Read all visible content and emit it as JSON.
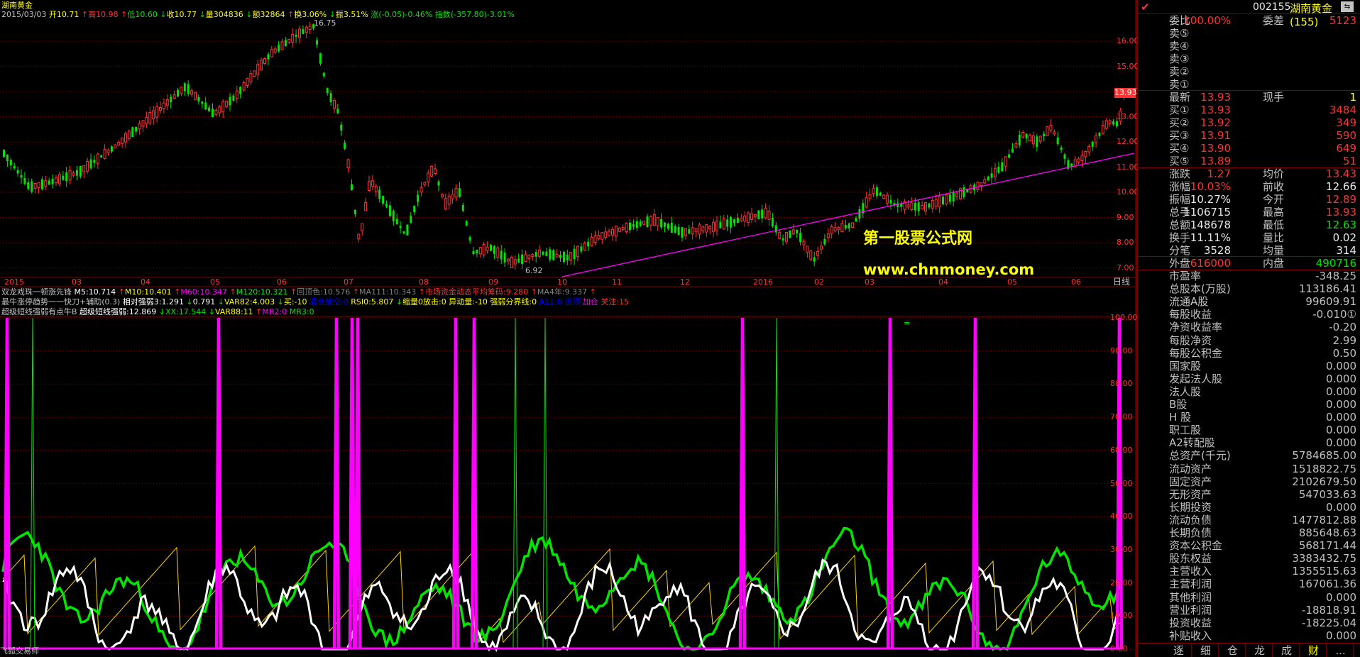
{
  "window": {
    "title": "湖南黄金",
    "footer": "飞狐交易师"
  },
  "info_line": {
    "date": "2015/03/03",
    "items": [
      {
        "t": "开10.71",
        "c": "#ffff00"
      },
      {
        "t": "↑",
        "c": "#ff3232"
      },
      {
        "t": "高10.98",
        "c": "#ff3232"
      },
      {
        "t": "↑",
        "c": "#ff3232"
      },
      {
        "t": "低10.60",
        "c": "#00e600"
      },
      {
        "t": "↓",
        "c": "#00e600"
      },
      {
        "t": "收10.77",
        "c": "#ffff00"
      },
      {
        "t": "↓",
        "c": "#00e600"
      },
      {
        "t": "量304836",
        "c": "#ffff00"
      },
      {
        "t": "↓",
        "c": "#00e600"
      },
      {
        "t": "额32864",
        "c": "#ffff00"
      },
      {
        "t": "↑",
        "c": "#ff3232"
      },
      {
        "t": "换3.06%",
        "c": "#ffff00"
      },
      {
        "t": "↓",
        "c": "#00e600"
      },
      {
        "t": "振3.51%",
        "c": "#ffff00"
      },
      {
        "t": "涨(-0.05)-0.46%",
        "c": "#00e600"
      },
      {
        "t": "指数(-357.80)-3.01%",
        "c": "#00e600"
      }
    ]
  },
  "main_chart": {
    "y_labels": [
      "16.00",
      "15.00",
      "14.00",
      "13.00",
      "12.00",
      "11.00",
      "10.00",
      "9.00",
      "8.00",
      "7.00"
    ],
    "current_price_tag": "13.93",
    "max_label": "16.75",
    "min_label": "6.92",
    "x_labels": [
      "2015",
      "03",
      "04",
      "05",
      "06",
      "07",
      "08",
      "09",
      "10",
      "11",
      "12",
      "2016",
      "02",
      "03",
      "04",
      "05",
      "06"
    ],
    "period_label": "日线"
  },
  "watermark": {
    "line1": "第一股票公式网",
    "line2": "www.chnmoney.com"
  },
  "indicator_lines": [
    [
      {
        "t": "双龙戏珠一顿涨先锋",
        "c": "#c0c0c0"
      },
      {
        "t": "M5:10.714",
        "c": "#ffffff"
      },
      {
        "t": "↑",
        "c": "#ff3232"
      },
      {
        "t": "M10:10.401",
        "c": "#ffff00"
      },
      {
        "t": "↑",
        "c": "#ff3232"
      },
      {
        "t": "M60:10.347",
        "c": "#ff00ff"
      },
      {
        "t": "↑",
        "c": "#ff3232"
      },
      {
        "t": "M120:10.321",
        "c": "#00e600"
      },
      {
        "t": "↑",
        "c": "#ff3232"
      },
      {
        "t": "回顶色:10.576",
        "c": "#808080"
      },
      {
        "t": "↑",
        "c": "#ff3232"
      },
      {
        "t": "MA111:10.343",
        "c": "#808080"
      },
      {
        "t": "↑",
        "c": "#ff3232"
      },
      {
        "t": "市场资金动态平均筹码:9.280",
        "c": "#ff3232"
      },
      {
        "t": "↑",
        "c": "#ff3232"
      },
      {
        "t": "MA4年:9.337",
        "c": "#808080"
      },
      {
        "t": "↑",
        "c": "#ff3232"
      }
    ],
    [
      {
        "t": "最牛涨停趋势一一快刀+辅助(0.3)",
        "c": "#c0c0c0"
      },
      {
        "t": "相对强弱3:1.291",
        "c": "#ffffff"
      },
      {
        "t": "↓",
        "c": "#00e600"
      },
      {
        "t": "0.791",
        "c": "#ffffff"
      },
      {
        "t": "↓",
        "c": "#00e600"
      },
      {
        "t": "VAR82:4.003",
        "c": "#ffff00"
      },
      {
        "t": "↓",
        "c": "#00e600"
      },
      {
        "t": "买:-10",
        "c": "#ffff00"
      },
      {
        "t": "清仓放空:0",
        "c": "#0000ff"
      },
      {
        "t": "RSI0:5.807",
        "c": "#ffff00"
      },
      {
        "t": "↓",
        "c": "#00e600"
      },
      {
        "t": "缩量0放击:0",
        "c": "#ffff00"
      },
      {
        "t": "异动量:-10",
        "c": "#ffff00"
      },
      {
        "t": "强弱分界线:0",
        "c": "#ffff00"
      },
      {
        "t": "A11:0",
        "c": "#0000ff"
      },
      {
        "t": "逃顶",
        "c": "#0000ff"
      },
      {
        "t": "加仓",
        "c": "#ff00ff"
      },
      {
        "t": "关注:15",
        "c": "#ff3232"
      }
    ],
    [
      {
        "t": "超级短线强弱有点牛B",
        "c": "#c0c0c0"
      },
      {
        "t": "超级短线强弱:12.869",
        "c": "#ffffff"
      },
      {
        "t": "↓",
        "c": "#00e600"
      },
      {
        "t": "XX:17.544",
        "c": "#00e600"
      },
      {
        "t": "↓",
        "c": "#00e600"
      },
      {
        "t": "VAR88:11",
        "c": "#ffff00"
      },
      {
        "t": "↑",
        "c": "#ff3232"
      },
      {
        "t": "MR2:0",
        "c": "#ff00ff"
      },
      {
        "t": "MR3:0",
        "c": "#00e600"
      }
    ]
  ],
  "sub_chart": {
    "y_labels": [
      "100.00",
      "90.00",
      "80.00",
      "70.00",
      "60.00",
      "50.00",
      "40.00",
      "30.00",
      "20.00",
      "10.00",
      "0.00"
    ],
    "marker": "="
  },
  "quote": {
    "code": "002155",
    "name": "湖南黄金(155)",
    "weibi": {
      "label": "委比",
      "value": "100.00%",
      "label2": "委差",
      "value2": "5123"
    },
    "asks": [
      {
        "label": "卖⑤",
        "price": "",
        "vol": ""
      },
      {
        "label": "卖④",
        "price": "",
        "vol": ""
      },
      {
        "label": "卖③",
        "price": "",
        "vol": ""
      },
      {
        "label": "卖②",
        "price": "",
        "vol": ""
      },
      {
        "label": "卖①",
        "price": "",
        "vol": ""
      }
    ],
    "latest": {
      "label": "最新",
      "value": "13.93",
      "label2": "现手",
      "value2": "1"
    },
    "bids": [
      {
        "label": "买①",
        "price": "13.93",
        "vol": "3484"
      },
      {
        "label": "买②",
        "price": "13.92",
        "vol": "349"
      },
      {
        "label": "买③",
        "price": "13.91",
        "vol": "590"
      },
      {
        "label": "买④",
        "price": "13.90",
        "vol": "649"
      },
      {
        "label": "买⑤",
        "price": "13.89",
        "vol": "51"
      }
    ],
    "stats": [
      {
        "l1": "涨跌",
        "v1": "1.27",
        "c1": "#ff3232",
        "l2": "均价",
        "v2": "13.43",
        "c2": "#ff3232"
      },
      {
        "l1": "涨幅",
        "v1": "10.03%",
        "c1": "#ff3232",
        "l2": "前收",
        "v2": "12.66",
        "c2": "#e8e8e8"
      },
      {
        "l1": "振幅",
        "v1": "10.27%",
        "c1": "#e8e8e8",
        "l2": "今开",
        "v2": "12.89",
        "c2": "#ff3232"
      },
      {
        "l1": "总手",
        "v1": "1106715",
        "c1": "#e8e8e8",
        "l2": "最高",
        "v2": "13.93",
        "c2": "#ff3232"
      },
      {
        "l1": "总额",
        "v1": "148678",
        "c1": "#e8e8e8",
        "l2": "最低",
        "v2": "12.63",
        "c2": "#00e600"
      },
      {
        "l1": "换手",
        "v1": "11.11%",
        "c1": "#e8e8e8",
        "l2": "量比",
        "v2": "0.02",
        "c2": "#e8e8e8"
      },
      {
        "l1": "分笔",
        "v1": "3528",
        "c1": "#e8e8e8",
        "l2": "均量",
        "v2": "314",
        "c2": "#e8e8e8"
      }
    ],
    "outer": {
      "label": "外盘",
      "value": "616000",
      "label2": "内盘",
      "value2": "490716"
    },
    "financials": [
      {
        "label": "市盈率",
        "value": "-348.25"
      },
      {
        "label": "总股本(万股)",
        "value": "113186.41"
      },
      {
        "label": "流通A股",
        "value": "99609.91"
      },
      {
        "label": "每股收益",
        "value": "-0.010①"
      },
      {
        "label": "净资收益率",
        "value": "-0.20"
      },
      {
        "label": "每股净资",
        "value": "2.99"
      },
      {
        "label": "每股公积金",
        "value": "0.50"
      },
      {
        "label": "国家股",
        "value": "0.000"
      },
      {
        "label": "发起法人股",
        "value": "0.000"
      },
      {
        "label": "法人股",
        "value": "0.000"
      },
      {
        "label": "B股",
        "value": "0.000"
      },
      {
        "label": "H 股",
        "value": "0.000"
      },
      {
        "label": "职工股",
        "value": "0.000"
      },
      {
        "label": "A2转配股",
        "value": "0.000"
      },
      {
        "label": "总资产(千元)",
        "value": "5784685.00"
      },
      {
        "label": "流动资产",
        "value": "1518822.75"
      },
      {
        "label": "固定资产",
        "value": "2102679.50"
      },
      {
        "label": "无形资产",
        "value": "547033.63"
      },
      {
        "label": "长期投资",
        "value": "0.000"
      },
      {
        "label": "流动负债",
        "value": "1477812.88"
      },
      {
        "label": "长期负债",
        "value": "885648.63"
      },
      {
        "label": "资本公积金",
        "value": "568171.44"
      },
      {
        "label": "股东权益",
        "value": "3383432.75"
      },
      {
        "label": "主营收入",
        "value": "1355515.63"
      },
      {
        "label": "主营利润",
        "value": "167061.36"
      },
      {
        "label": "其他利润",
        "value": "0.000"
      },
      {
        "label": "营业利润",
        "value": "-18818.91"
      },
      {
        "label": "投资收益",
        "value": "-18225.04"
      },
      {
        "label": "补贴收入",
        "value": "0.000"
      }
    ],
    "tabs": [
      "逐",
      "细",
      "仓",
      "龙",
      "成",
      "财",
      "..."
    ],
    "active_tab": 5
  },
  "colors": {
    "up": "#ff3232",
    "down": "#00e600",
    "frame": "#800000",
    "ma_line": "#ff00ff"
  }
}
